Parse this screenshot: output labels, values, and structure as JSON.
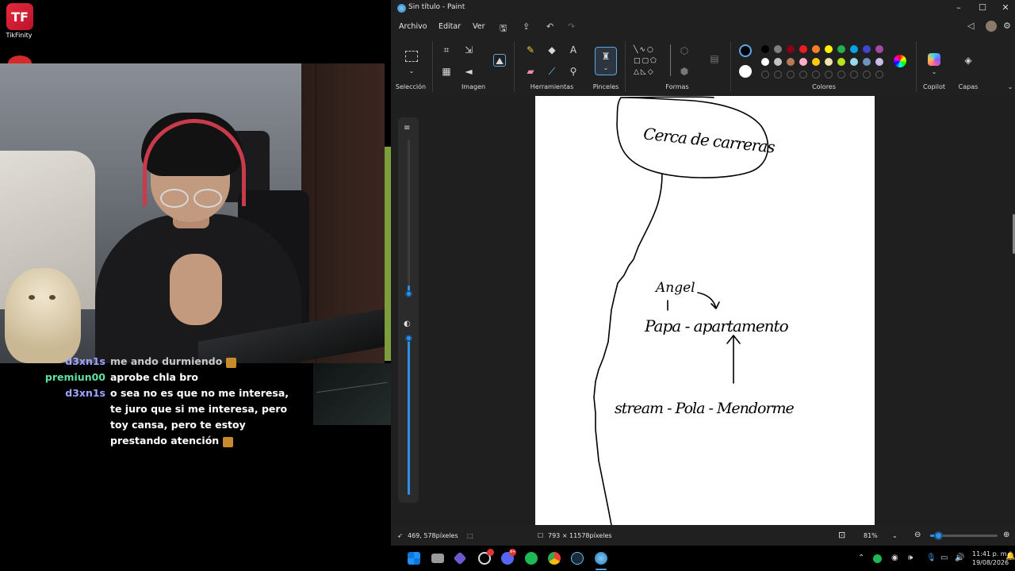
{
  "overlay": {
    "tikfinity_logo_text": "TF",
    "tikfinity_label": "TikFinity"
  },
  "chat": [
    {
      "user": "d3xn1s",
      "message": "me ando durmiendo",
      "user_color": "#9ea6ff",
      "cut": true
    },
    {
      "user": "premiun00",
      "message": "aprobe chla bro",
      "user_color": "#5ee0a0"
    },
    {
      "user": "d3xn1s",
      "message": "o sea no es que no me interesa,",
      "user_color": "#9ea6ff"
    },
    {
      "user": "",
      "message": "te juro que si me interesa, pero",
      "user_color": "#9ea6ff"
    },
    {
      "user": "",
      "message": "toy cansa, pero te estoy",
      "user_color": "#9ea6ff"
    },
    {
      "user": "",
      "message": "prestando atención",
      "user_color": "#9ea6ff"
    }
  ],
  "paint": {
    "title": "Sin título - Paint",
    "menu": {
      "archivo": "Archivo",
      "editar": "Editar",
      "ver": "Ver"
    },
    "groups": {
      "seleccion": "Selección",
      "imagen": "Imagen",
      "herramientas": "Herramientas",
      "pinceles": "Pinceles",
      "formas": "Formas",
      "colores": "Colores",
      "copilot": "Copilot",
      "capas": "Capas"
    },
    "colors": {
      "primary": "#000000",
      "secondary": "#ffffff",
      "row1": [
        "#000000",
        "#7f7f7f",
        "#880015",
        "#ed1c24",
        "#ff7f27",
        "#fff200",
        "#22b14c",
        "#00a2e8",
        "#3f48cc",
        "#a349a4"
      ],
      "row2": [
        "#ffffff",
        "#c3c3c3",
        "#b97a57",
        "#ffaec9",
        "#ffc90e",
        "#efe4b0",
        "#b5e61d",
        "#99d9ea",
        "#7092be",
        "#c8bfe7"
      ]
    },
    "canvas_text": {
      "bubble": "Cerca de carreras",
      "angel": "Angel",
      "row1": "Papa - apartamento",
      "row2": "stream - Pola - Mendorme"
    },
    "status": {
      "cursor_pos": "469, 578píxeles",
      "canvas_size": "793 × 11578píxeles",
      "zoom": "81%"
    }
  },
  "taskbar": {
    "time": "11:41 p. m.",
    "date": "19/08/2026",
    "discord_badge": "9+"
  }
}
